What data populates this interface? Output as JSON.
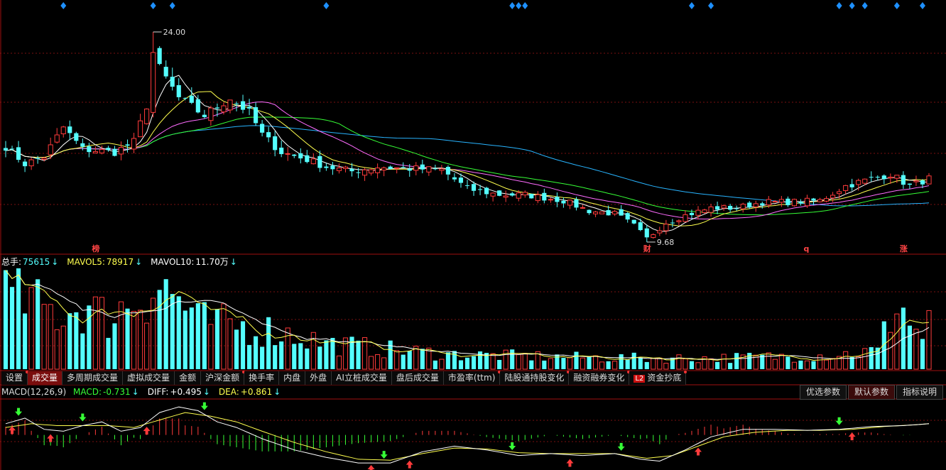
{
  "colors": {
    "up": "#ff3b3b",
    "down": "#54ffff",
    "ma5": "#ffffff",
    "ma10": "#ffff4e",
    "ma20": "#ff6cff",
    "ma30": "#36ff36",
    "ma60": "#28b4ff",
    "grid": "#7a1010",
    "separator": "#a01010",
    "marker": "#1e90ff"
  },
  "price_panel": {
    "high_label": "24.00",
    "low_label": "9.68",
    "event_tags": [
      {
        "index": 14,
        "text": "榜"
      },
      {
        "index": 100,
        "text": "财"
      },
      {
        "index": 125,
        "text": "q"
      },
      {
        "index": 140,
        "text": "涨"
      }
    ],
    "diamond_indices": [
      9,
      23,
      26,
      50,
      79,
      80,
      81,
      107,
      110,
      130,
      132,
      134,
      139,
      143
    ]
  },
  "volume_panel": {
    "legend": [
      {
        "label": "总手:",
        "value": "75615",
        "color": "#ffffff",
        "arrow": "↓"
      },
      {
        "label": "MAVOL5:",
        "value": "78917",
        "color": "#ffff4e",
        "arrow": "↓"
      },
      {
        "label": "MAVOL10:",
        "value": "11.70万",
        "color": "#ffffff",
        "arrow": "↓"
      }
    ]
  },
  "tabs": [
    {
      "label": "设置",
      "dot": true
    },
    {
      "label": "成交量",
      "active": true
    },
    {
      "label": "多周期成交量"
    },
    {
      "label": "虚拟成交量"
    },
    {
      "label": "金额"
    },
    {
      "label": "沪深金额",
      "dot": true
    },
    {
      "label": "换手率"
    },
    {
      "label": "内盘"
    },
    {
      "label": "外盘"
    },
    {
      "label": "AI立桩成交量"
    },
    {
      "label": "盘后成交量"
    },
    {
      "label": "市盈率(ttm)",
      "dot": true
    },
    {
      "label": "陆股通持股变化",
      "dot": true
    },
    {
      "label": "融资融券变化",
      "dot": true
    },
    {
      "label": "资金抄底",
      "badge": "L2",
      "dot": true
    }
  ],
  "macd_panel": {
    "title": "MACD(12,26,9)",
    "legend": [
      {
        "label": "MACD:",
        "value": "-0.731",
        "color": "#36ff36",
        "arrow": "↓"
      },
      {
        "label": "DIFF:",
        "value": "+0.495",
        "color": "#ffffff",
        "arrow": "↓"
      },
      {
        "label": "DEA:",
        "value": "+0.861",
        "color": "#ffff4e",
        "arrow": "↓"
      }
    ],
    "buttons": [
      {
        "label": "优选参数"
      },
      {
        "label": "默认参数",
        "active": true
      },
      {
        "label": "指标说明"
      }
    ]
  },
  "chart_data": {
    "type": "candlestick",
    "x": "trading day index 0-144",
    "ylim": [
      9.0,
      25.5
    ],
    "close_path": [
      [
        0,
        16.2
      ],
      [
        3,
        15.0
      ],
      [
        6,
        15.5
      ],
      [
        9,
        17.5
      ],
      [
        12,
        16.0
      ],
      [
        17,
        15.8
      ],
      [
        20,
        16.5
      ],
      [
        24,
        21.5
      ],
      [
        27,
        19.5
      ],
      [
        31,
        18.3
      ],
      [
        35,
        19.5
      ],
      [
        38,
        18.5
      ],
      [
        40,
        17.0
      ],
      [
        43,
        15.8
      ],
      [
        47,
        15.3
      ],
      [
        50,
        14.8
      ],
      [
        54,
        14.5
      ],
      [
        58,
        14.8
      ],
      [
        62,
        14.7
      ],
      [
        68,
        14.6
      ],
      [
        72,
        13.3
      ],
      [
        77,
        12.9
      ],
      [
        81,
        12.9
      ],
      [
        87,
        12.5
      ],
      [
        91,
        11.8
      ],
      [
        95,
        11.6
      ],
      [
        98,
        10.8
      ],
      [
        100,
        9.9
      ],
      [
        103,
        11.0
      ],
      [
        106,
        11.5
      ],
      [
        110,
        12.0
      ],
      [
        114,
        12.0
      ],
      [
        118,
        12.4
      ],
      [
        122,
        12.4
      ],
      [
        127,
        12.5
      ],
      [
        131,
        13.5
      ],
      [
        135,
        14.0
      ],
      [
        138,
        14.3
      ],
      [
        141,
        13.5
      ],
      [
        144,
        14.0
      ]
    ],
    "volume_ylim": [
      0,
      130000
    ],
    "volume_path": [
      [
        0,
        100000
      ],
      [
        4,
        90000
      ],
      [
        8,
        75000
      ],
      [
        12,
        85000
      ],
      [
        16,
        70000
      ],
      [
        20,
        95000
      ],
      [
        24,
        115000
      ],
      [
        27,
        95000
      ],
      [
        30,
        65000
      ],
      [
        35,
        60000
      ],
      [
        40,
        55000
      ],
      [
        46,
        45000
      ],
      [
        50,
        35000
      ],
      [
        56,
        30000
      ],
      [
        62,
        25000
      ],
      [
        70,
        20000
      ],
      [
        80,
        18000
      ],
      [
        90,
        16000
      ],
      [
        100,
        15000
      ],
      [
        110,
        15000
      ],
      [
        120,
        17000
      ],
      [
        130,
        20000
      ],
      [
        136,
        25000
      ],
      [
        139,
        95000
      ],
      [
        142,
        50000
      ],
      [
        144,
        40000
      ]
    ],
    "macd_ylim": [
      -1.8,
      2.0
    ],
    "diff_path": [
      [
        0,
        0.6
      ],
      [
        3,
        0.9
      ],
      [
        6,
        0.3
      ],
      [
        9,
        0.2
      ],
      [
        12,
        0.5
      ],
      [
        15,
        0.7
      ],
      [
        18,
        0.2
      ],
      [
        21,
        0.4
      ],
      [
        24,
        1.2
      ],
      [
        27,
        1.5
      ],
      [
        30,
        1.3
      ],
      [
        33,
        0.7
      ],
      [
        36,
        0.4
      ],
      [
        40,
        -0.2
      ],
      [
        45,
        -0.8
      ],
      [
        50,
        -1.2
      ],
      [
        55,
        -1.5
      ],
      [
        60,
        -1.5
      ],
      [
        65,
        -0.9
      ],
      [
        70,
        -0.6
      ],
      [
        75,
        -0.8
      ],
      [
        80,
        -1.1
      ],
      [
        85,
        -1.0
      ],
      [
        90,
        -1.1
      ],
      [
        95,
        -1.0
      ],
      [
        99,
        -1.3
      ],
      [
        102,
        -1.4
      ],
      [
        106,
        -0.8
      ],
      [
        110,
        -0.1
      ],
      [
        115,
        0.3
      ],
      [
        120,
        0.3
      ],
      [
        125,
        0.25
      ],
      [
        130,
        0.3
      ],
      [
        135,
        0.45
      ],
      [
        140,
        0.5
      ],
      [
        144,
        0.6
      ]
    ],
    "dea_path": [
      [
        0,
        0.4
      ],
      [
        4,
        0.6
      ],
      [
        8,
        0.5
      ],
      [
        12,
        0.5
      ],
      [
        16,
        0.5
      ],
      [
        20,
        0.4
      ],
      [
        24,
        0.8
      ],
      [
        28,
        1.2
      ],
      [
        32,
        1.0
      ],
      [
        36,
        0.7
      ],
      [
        40,
        0.2
      ],
      [
        45,
        -0.4
      ],
      [
        50,
        -0.9
      ],
      [
        55,
        -1.3
      ],
      [
        60,
        -1.35
      ],
      [
        65,
        -1.0
      ],
      [
        70,
        -0.7
      ],
      [
        75,
        -0.75
      ],
      [
        80,
        -0.95
      ],
      [
        85,
        -1.0
      ],
      [
        90,
        -1.0
      ],
      [
        95,
        -1.0
      ],
      [
        100,
        -1.25
      ],
      [
        104,
        -1.1
      ],
      [
        108,
        -0.6
      ],
      [
        112,
        -0.1
      ],
      [
        117,
        0.15
      ],
      [
        122,
        0.25
      ],
      [
        127,
        0.25
      ],
      [
        132,
        0.3
      ],
      [
        137,
        0.45
      ],
      [
        142,
        0.55
      ],
      [
        144,
        0.6
      ]
    ],
    "macd_signals": [
      {
        "index": 1,
        "type": "up"
      },
      {
        "index": 2,
        "type": "down"
      },
      {
        "index": 7,
        "type": "up"
      },
      {
        "index": 12,
        "type": "down"
      },
      {
        "index": 22,
        "type": "up"
      },
      {
        "index": 31,
        "type": "down"
      },
      {
        "index": 57,
        "type": "up"
      },
      {
        "index": 59,
        "type": "down"
      },
      {
        "index": 63,
        "type": "up"
      },
      {
        "index": 79,
        "type": "down"
      },
      {
        "index": 88,
        "type": "up"
      },
      {
        "index": 96,
        "type": "down"
      },
      {
        "index": 108,
        "type": "up"
      },
      {
        "index": 130,
        "type": "down"
      },
      {
        "index": 132,
        "type": "up"
      }
    ]
  }
}
